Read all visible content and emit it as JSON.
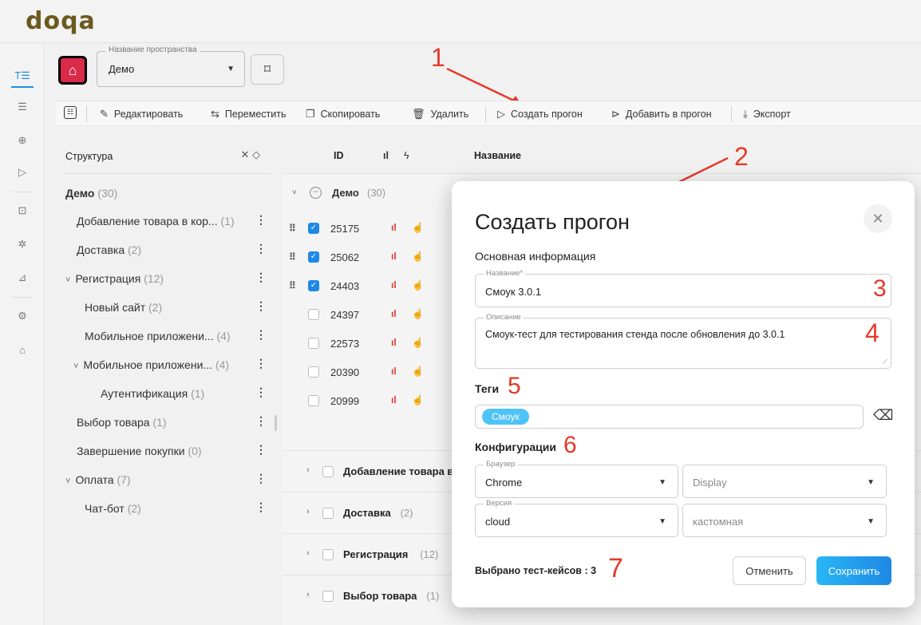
{
  "app": {
    "logo": "doqa"
  },
  "nav": {
    "items": [
      "test-cases-icon",
      "checklist-icon",
      "add-icon",
      "play-icon",
      "archive-icon",
      "bug-icon",
      "chart-icon",
      "settings-icon",
      "trash-icon"
    ]
  },
  "space": {
    "label": "Название пространства",
    "value": "Демо"
  },
  "toolbar": {
    "edit": "Редактировать",
    "move": "Переместить",
    "copy": "Скопировать",
    "delete": "Удалить",
    "create_run": "Создать прогон",
    "add_to_run": "Добавить в прогон",
    "export": "Экспорт"
  },
  "structure": {
    "title": "Структура",
    "root": "Демо",
    "root_count": "(30)",
    "items": [
      {
        "label": "Добавление товара в кор...",
        "count": "(1)"
      },
      {
        "label": "Доставка",
        "count": "(2)"
      },
      {
        "label": "Регистрация",
        "count": "(12)",
        "chevron": "˅"
      },
      {
        "label": "Новый сайт",
        "count": "(2)"
      },
      {
        "label": "Мобильное приложени...",
        "count": "(4)"
      },
      {
        "label": "Мобильное приложени...",
        "count": "(4)",
        "chevron": "˅"
      },
      {
        "label": "Аутентификация",
        "count": "(1)"
      },
      {
        "label": "Выбор товара",
        "count": "(1)"
      },
      {
        "label": "Завершение покупки",
        "count": "(0)"
      },
      {
        "label": "Оплата",
        "count": "(7)",
        "chevron": "˅"
      },
      {
        "label": "Чат-бот",
        "count": "(2)"
      }
    ]
  },
  "table": {
    "col_id": "ID",
    "col_name": "Название",
    "group": "Демо",
    "group_count": "(30)",
    "rows": [
      {
        "id": "25175",
        "checked": true
      },
      {
        "id": "25062",
        "checked": true
      },
      {
        "id": "24403",
        "checked": true
      },
      {
        "id": "24397",
        "checked": false
      },
      {
        "id": "22573",
        "checked": false
      },
      {
        "id": "20390",
        "checked": false
      },
      {
        "id": "20999",
        "checked": false
      }
    ],
    "groups": [
      {
        "label": "Добавление товара в",
        "count": ""
      },
      {
        "label": "Доставка",
        "count": "(2)"
      },
      {
        "label": "Регистрация",
        "count": "(12)"
      },
      {
        "label": "Выбор товара",
        "count": "(1)"
      }
    ]
  },
  "modal": {
    "title": "Создать прогон",
    "section_main": "Основная информация",
    "name_label": "Название*",
    "name_value": "Смоук 3.0.1",
    "desc_label": "Описание",
    "desc_value": "Смоук-тест для тестирования стенда после обновления до 3.0.1",
    "tags_title": "Теги",
    "tag": "Смоук",
    "config_title": "Конфигурации",
    "browser_label": "Браузер",
    "browser_value": "Chrome",
    "display_placeholder": "Display",
    "version_label": "Версия",
    "version_value": "cloud",
    "custom_placeholder": "кастомная",
    "selected_text": "Выбрано тест-кейсов : 3",
    "cancel": "Отменить",
    "save": "Сохранить"
  },
  "annotations": {
    "a1": "1",
    "a2": "2",
    "a3": "3",
    "a4": "4",
    "a5": "5",
    "a6": "6",
    "a7": "7"
  },
  "colors": {
    "accent": "#1e88e5",
    "annotation": "#e53929",
    "tag": "#4fc3f7",
    "save_gradient_from": "#29b6f6",
    "save_gradient_to": "#1e88e5"
  }
}
